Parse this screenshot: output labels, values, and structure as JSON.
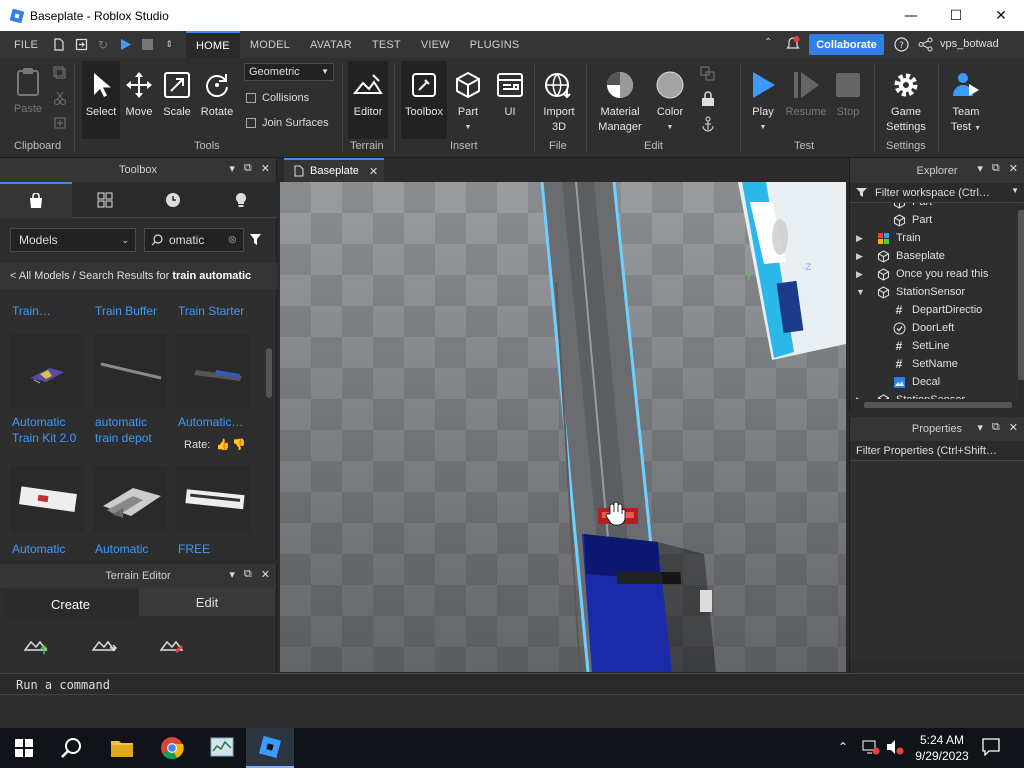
{
  "window": {
    "title": "Baseplate - Roblox Studio"
  },
  "menu": {
    "file": "FILE",
    "tabs": [
      "HOME",
      "MODEL",
      "AVATAR",
      "TEST",
      "VIEW",
      "PLUGINS"
    ],
    "collaborate": "Collaborate",
    "user": "vps_botwad"
  },
  "ribbon": {
    "clipboard": {
      "paste": "Paste",
      "group": "Clipboard"
    },
    "tools": {
      "select": "Select",
      "move": "Move",
      "scale": "Scale",
      "rotate": "Rotate",
      "group": "Tools",
      "mode_value": "Geometric",
      "collisions": "Collisions",
      "join_surfaces": "Join Surfaces"
    },
    "terrain": {
      "editor": "Editor",
      "group": "Terrain"
    },
    "insert": {
      "toolbox": "Toolbox",
      "part": "Part",
      "ui": "UI",
      "group": "Insert"
    },
    "file": {
      "import_line1": "Import",
      "import_line2": "3D",
      "group": "File"
    },
    "edit": {
      "material_line1": "Material",
      "material_line2": "Manager",
      "color": "Color",
      "group": "Edit"
    },
    "test": {
      "play": "Play",
      "resume": "Resume",
      "stop": "Stop",
      "group": "Test"
    },
    "settings": {
      "game_line1": "Game",
      "game_line2": "Settings",
      "group": "Settings"
    },
    "team": {
      "line1": "Team",
      "line2": "Test"
    }
  },
  "toolbox": {
    "title": "Toolbox",
    "category": "Models",
    "search_value": "omatic",
    "breadcrumb_prefix": "< All Models / Search Results for ",
    "breadcrumb_query": "train automatic",
    "top_row": [
      "Train…",
      "Train Buffer",
      "Train Starter"
    ],
    "items": [
      {
        "line1": "Automatic",
        "line2": "Train Kit 2.0"
      },
      {
        "line1": "automatic",
        "line2": "train depot"
      },
      {
        "line1": "Automatic…",
        "line2": ""
      }
    ],
    "rate_label": "Rate:",
    "items2": [
      "Automatic",
      "Automatic",
      "FREE"
    ]
  },
  "terrain_editor": {
    "title": "Terrain Editor",
    "tab_create": "Create",
    "tab_edit": "Edit"
  },
  "viewport": {
    "tab": "Baseplate"
  },
  "explorer": {
    "title": "Explorer",
    "filter_placeholder": "Filter workspace (Ctrl…",
    "rows": [
      {
        "label": "Part",
        "indent": 1,
        "icon": "part"
      },
      {
        "label": "Part",
        "indent": 1,
        "icon": "part"
      },
      {
        "label": "Train",
        "indent": 0,
        "icon": "model",
        "arrow": "▶"
      },
      {
        "label": "Baseplate",
        "indent": 0,
        "icon": "part",
        "arrow": "▶"
      },
      {
        "label": "Once you read this",
        "indent": 0,
        "icon": "part",
        "arrow": "▶"
      },
      {
        "label": "StationSensor",
        "indent": 0,
        "icon": "part",
        "arrow": "▼"
      },
      {
        "label": "DepartDirectio",
        "indent": 1,
        "icon": "number"
      },
      {
        "label": "DoorLeft",
        "indent": 1,
        "icon": "bool"
      },
      {
        "label": "SetLine",
        "indent": 1,
        "icon": "number"
      },
      {
        "label": "SetName",
        "indent": 1,
        "icon": "number"
      },
      {
        "label": "Decal",
        "indent": 1,
        "icon": "decal"
      },
      {
        "label": "StationSensor",
        "indent": 0,
        "icon": "part",
        "arrow": "▶"
      }
    ]
  },
  "properties": {
    "title": "Properties",
    "filter_placeholder": "Filter Properties (Ctrl+Shift…"
  },
  "command_bar": {
    "placeholder": "Run a command"
  },
  "taskbar": {
    "time": "5:24 AM",
    "date": "9/29/2023"
  }
}
